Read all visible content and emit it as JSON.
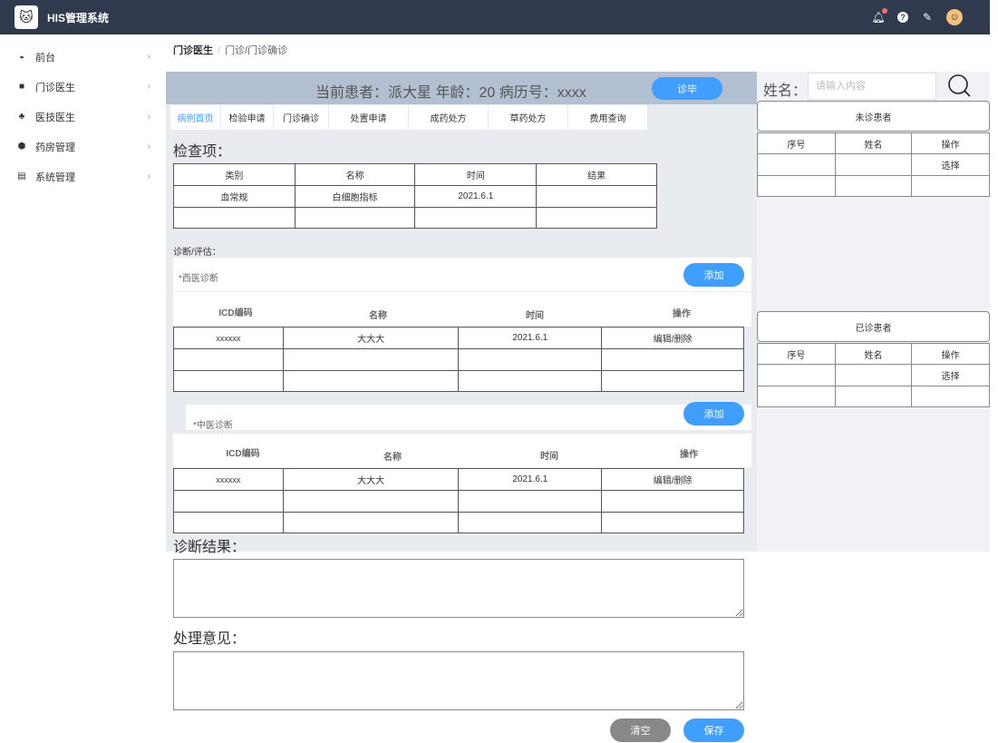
{
  "app": {
    "title": "HIS管理系统"
  },
  "sidebar": {
    "items": [
      {
        "label": "前台",
        "icon": "dashboard-icon"
      },
      {
        "label": "门诊医生",
        "icon": "briefcase-icon"
      },
      {
        "label": "医技医生",
        "icon": "team-icon"
      },
      {
        "label": "药房管理",
        "icon": "box-icon"
      },
      {
        "label": "系统管理",
        "icon": "document-icon"
      }
    ]
  },
  "breadcrumb": {
    "root": "门诊医生",
    "path": "门诊/门诊确诊"
  },
  "patient": {
    "info": "当前患者：派大星  年龄：20  病历号：xxxx",
    "finish_label": "诊毕"
  },
  "tabs": [
    "病例首页",
    "检验申请",
    "门诊确诊",
    "处置申请",
    "成药处方",
    "草药处方",
    "费用查询"
  ],
  "checks": {
    "title": "检查项：",
    "headers": [
      "类别",
      "名称",
      "时间",
      "结果"
    ],
    "rows": [
      [
        "血常规",
        "白细胞指标",
        "2021.6.1",
        ""
      ],
      [
        "",
        "",
        "",
        ""
      ]
    ]
  },
  "diagnosis": {
    "label": "诊断/评估：",
    "western": {
      "label": "*西医诊断",
      "add_label": "添加",
      "headers": [
        "ICD编码",
        "名称",
        "时间",
        "操作"
      ],
      "rows": [
        [
          "xxxxxx",
          "大大大",
          "2021.6.1",
          "编辑/删除"
        ],
        [
          "",
          "",
          "",
          ""
        ],
        [
          "",
          "",
          "",
          ""
        ]
      ]
    },
    "chinese": {
      "label": "*中医诊断",
      "add_label": "添加",
      "headers": [
        "ICD编码",
        "名称",
        "时间",
        "操作"
      ],
      "rows": [
        [
          "xxxxxx",
          "大大大",
          "2021.6.1",
          "编辑/删除"
        ],
        [
          "",
          "",
          "",
          ""
        ],
        [
          "",
          "",
          "",
          ""
        ]
      ]
    }
  },
  "result": {
    "label": "诊断结果："
  },
  "advice": {
    "label": "处理意见："
  },
  "actions": {
    "clear_label": "清空",
    "save_label": "保存"
  },
  "search": {
    "label": "姓名：",
    "placeholder": "请输入内容"
  },
  "unseen": {
    "title": "未诊患者",
    "headers": [
      "序号",
      "姓名",
      "操作"
    ],
    "rows": [
      [
        "",
        "",
        "选择"
      ],
      [
        "",
        "",
        ""
      ]
    ]
  },
  "seen": {
    "title": "已诊患者",
    "headers": [
      "序号",
      "姓名",
      "操作"
    ],
    "rows": [
      [
        "",
        "",
        "选择"
      ],
      [
        "",
        "",
        ""
      ]
    ]
  },
  "colors": {
    "topbar": "#2f3a4f",
    "accent": "#409eff",
    "patient_bar": "#b3c0d1",
    "panel": "#e8ecf0"
  }
}
